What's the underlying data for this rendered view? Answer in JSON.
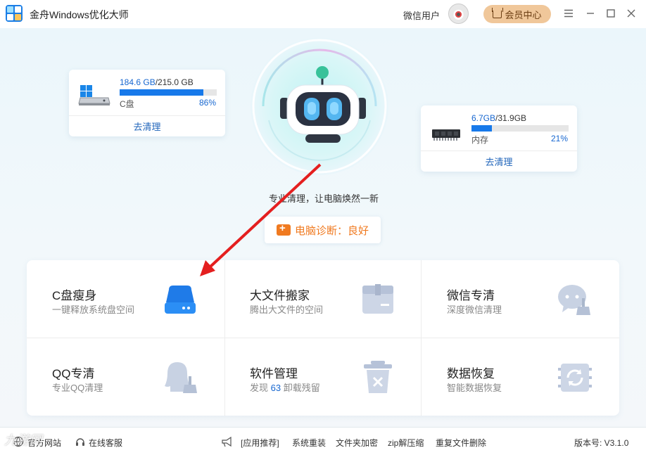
{
  "app": {
    "title": "金舟Windows优化大师"
  },
  "header": {
    "user_name": "微信用户",
    "vip_label": "会员中心",
    "menu_icon": "hamburger-icon",
    "minimize_icon": "minimize-icon",
    "maximize_icon": "maximize-icon",
    "close_icon": "close-icon"
  },
  "disk_card": {
    "used": "184.6 GB",
    "total": "/215.0 GB",
    "label": "C盘",
    "percent_text": "86%",
    "percent": 86,
    "action": "去清理"
  },
  "memory_card": {
    "used": "6.7GB",
    "total": "/31.9GB",
    "label": "内存",
    "percent_text": "21%",
    "percent": 21,
    "action": "去清理"
  },
  "center": {
    "tagline": "专业清理，让电脑焕然一新",
    "diagnosis": "电脑诊断：良好"
  },
  "tools": [
    {
      "title": "C盘瘦身",
      "subtitle": "一键释放系统盘空间",
      "icon": "disk-icon"
    },
    {
      "title": "大文件搬家",
      "subtitle": "腾出大文件的空间",
      "icon": "box-icon"
    },
    {
      "title": "微信专清",
      "subtitle": "深度微信清理",
      "icon": "chat-broom-icon"
    },
    {
      "title": "QQ专清",
      "subtitle": "专业QQ清理",
      "icon": "qq-broom-icon"
    },
    {
      "title": "软件管理",
      "subtitle_prefix": "发现 ",
      "subtitle_num": "63",
      "subtitle_suffix": " 卸载残留",
      "icon": "trash-icon"
    },
    {
      "title": "数据恢复",
      "subtitle": "智能数据恢复",
      "icon": "recover-icon"
    }
  ],
  "footer": {
    "official_site": "官方网站",
    "online_service": "在线客服",
    "recommend": "[应用推荐]",
    "links": [
      "系统重装",
      "文件夹加密",
      "zip解压缩",
      "重复文件删除"
    ],
    "version": "版本号: V3.1.0"
  },
  "watermark": "九游网"
}
